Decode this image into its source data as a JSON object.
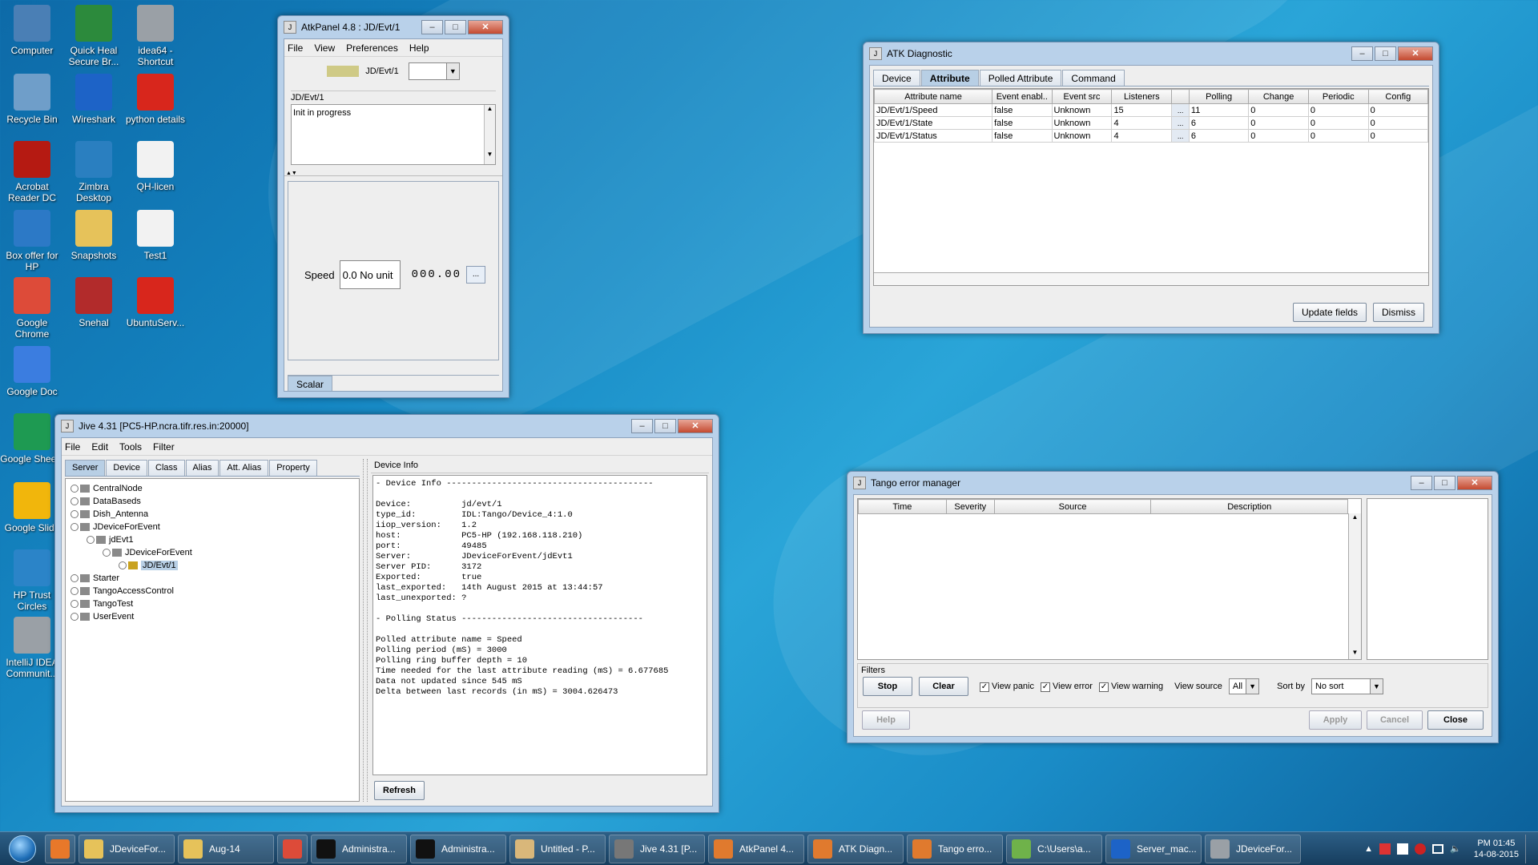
{
  "desktop_icons": [
    {
      "label": "Computer",
      "icon": "computer-icon",
      "color": "#4a7fb5"
    },
    {
      "label": "Quick Heal Secure Br...",
      "icon": "quick-heal-icon",
      "color": "#2c8a3c"
    },
    {
      "label": "idea64 - Shortcut",
      "icon": "intellij-icon",
      "color": "#9aa0a6"
    },
    {
      "label": "Recycle Bin",
      "icon": "recycle-bin-icon",
      "color": "#6f9ec9"
    },
    {
      "label": "Wireshark",
      "icon": "wireshark-icon",
      "color": "#1d63c7"
    },
    {
      "label": "python details",
      "icon": "pdf-icon",
      "color": "#d8261c"
    },
    {
      "label": "Acrobat Reader DC",
      "icon": "acrobat-icon",
      "color": "#b51a12"
    },
    {
      "label": "Zimbra Desktop",
      "icon": "zimbra-icon",
      "color": "#2a7fc0"
    },
    {
      "label": "QH-licen",
      "icon": "text-file-icon",
      "color": "#f2f2f2"
    },
    {
      "label": "Box offer for HP",
      "icon": "box-icon",
      "color": "#2c79c6"
    },
    {
      "label": "Snapshots",
      "icon": "folder-icon",
      "color": "#e6c25a"
    },
    {
      "label": "Test1",
      "icon": "binary-file-icon",
      "color": "#f2f2f2"
    },
    {
      "label": "Google Chrome",
      "icon": "chrome-icon",
      "color": "#dd4b39"
    },
    {
      "label": "Snehal",
      "icon": "winrar-icon",
      "color": "#b22b2b"
    },
    {
      "label": "UbuntuServ...",
      "icon": "pdf-icon",
      "color": "#d8261c"
    },
    {
      "label": "Google Doc",
      "icon": "google-docs-icon",
      "color": "#3b7de0"
    },
    {
      "label": "Google Sheets",
      "icon": "google-sheets-icon",
      "color": "#1e9a52"
    },
    {
      "label": "Google Slide",
      "icon": "google-slides-icon",
      "color": "#f1b60c"
    },
    {
      "label": "HP Trust Circles",
      "icon": "hp-trust-icon",
      "color": "#2b84c8"
    },
    {
      "label": "IntelliJ IDEA Communit...",
      "icon": "intellij-icon",
      "color": "#9aa0a6"
    }
  ],
  "atkpanel": {
    "title": "AtkPanel  4.8  : JD/Evt/1",
    "menu": [
      "File",
      "View",
      "Preferences",
      "Help"
    ],
    "device_name": "JD/Evt/1",
    "status_color": "#cfca86",
    "group_label": "JD/Evt/1",
    "status_text": "Init in progress",
    "attr_label": "Speed",
    "attr_value": "0.0 No unit",
    "wheel_digits": "000.00",
    "ellipsis": "...",
    "tab": "Scalar"
  },
  "atk_diagnostic": {
    "title": "ATK Diagnostic",
    "tabs": [
      "Device",
      "Attribute",
      "Polled Attribute",
      "Command"
    ],
    "selected_tab": 1,
    "columns": [
      "Attribute name",
      "Event enabl..",
      "Event src",
      "Listeners",
      "",
      "Polling",
      "Change",
      "Periodic",
      "Config"
    ],
    "rows": [
      [
        "JD/Evt/1/Speed",
        "false",
        "Unknown",
        "15",
        "...",
        "11",
        "0",
        "0",
        "0"
      ],
      [
        "JD/Evt/1/State",
        "false",
        "Unknown",
        "4",
        "...",
        "6",
        "0",
        "0",
        "0"
      ],
      [
        "JD/Evt/1/Status",
        "false",
        "Unknown",
        "4",
        "...",
        "6",
        "0",
        "0",
        "0"
      ]
    ],
    "update_label": "Update fields",
    "dismiss_label": "Dismiss"
  },
  "jive": {
    "title": "Jive 4.31  [PC5-HP.ncra.tifr.res.in:20000]",
    "menu": [
      "File",
      "Edit",
      "Tools",
      "Filter"
    ],
    "tabs": [
      "Server",
      "Device",
      "Class",
      "Alias",
      "Att. Alias",
      "Property"
    ],
    "tree": [
      {
        "label": "CentralNode",
        "level": 0
      },
      {
        "label": "DataBaseds",
        "level": 0
      },
      {
        "label": "Dish_Antenna",
        "level": 0
      },
      {
        "label": "JDeviceForEvent",
        "level": 0
      },
      {
        "label": "jdEvt1",
        "level": 1
      },
      {
        "label": "JDeviceForEvent",
        "level": 2
      },
      {
        "label": "JD/Evt/1",
        "level": 3,
        "selected": true
      },
      {
        "label": "Starter",
        "level": 0
      },
      {
        "label": "TangoAccessControl",
        "level": 0
      },
      {
        "label": "TangoTest",
        "level": 0
      },
      {
        "label": "UserEvent",
        "level": 0
      }
    ],
    "info_title": "Device Info",
    "info_lines": [
      "- Device Info -----------------------------------------",
      "",
      "Device:          jd/evt/1",
      "type_id:         IDL:Tango/Device_4:1.0",
      "iiop_version:    1.2",
      "host:            PC5-HP (192.168.118.210)",
      "port:            49485",
      "Server:          JDeviceForEvent/jdEvt1",
      "Server PID:      3172",
      "Exported:        true",
      "last_exported:   14th August 2015 at 13:44:57",
      "last_unexported: ?",
      "",
      "- Polling Status ------------------------------------",
      "",
      "Polled attribute name = Speed",
      "Polling period (mS) = 3000",
      "Polling ring buffer depth = 10",
      "Time needed for the last attribute reading (mS) = 6.677685",
      "Data not updated since 545 mS",
      "Delta between last records (in mS) = 3004.626473"
    ],
    "refresh_label": "Refresh"
  },
  "tango_error": {
    "title": "Tango error manager",
    "columns": [
      "Time",
      "Severity",
      "Source",
      "Description"
    ],
    "filters_label": "Filters",
    "stop_label": "Stop",
    "clear_label": "Clear",
    "view_panic": "View panic",
    "view_error": "View error",
    "view_warning": "View warning",
    "view_source_label": "View source",
    "view_source_value": "All",
    "sort_label": "Sort by",
    "sort_value": "No sort",
    "help_label": "Help",
    "apply_label": "Apply",
    "cancel_label": "Cancel",
    "close_label": "Close"
  },
  "taskbar": {
    "items": [
      {
        "label": "",
        "icon": "media-player-icon",
        "color": "#e8782a"
      },
      {
        "label": "JDeviceFor...",
        "icon": "folder-icon",
        "color": "#e6c25a"
      },
      {
        "label": "Aug-14",
        "icon": "folder-icon",
        "color": "#e6c25a"
      },
      {
        "label": "",
        "icon": "chrome-icon",
        "color": "#dd4b39"
      },
      {
        "label": "Administra...",
        "icon": "cmd-icon",
        "color": "#111111"
      },
      {
        "label": "Administra...",
        "icon": "cmd-icon",
        "color": "#111111"
      },
      {
        "label": "Untitled - P...",
        "icon": "paint-icon",
        "color": "#d9b77a"
      },
      {
        "label": "Jive 4.31  [P...",
        "icon": "java-icon",
        "color": "#777777"
      },
      {
        "label": "AtkPanel 4...",
        "icon": "java-icon",
        "color": "#e07a2e"
      },
      {
        "label": "ATK Diagn...",
        "icon": "java-icon",
        "color": "#e07a2e"
      },
      {
        "label": "Tango erro...",
        "icon": "java-icon",
        "color": "#e07a2e"
      },
      {
        "label": "C:\\Users\\a...",
        "icon": "notepad-icon",
        "color": "#6fb24a"
      },
      {
        "label": "Server_mac...",
        "icon": "wireshark-icon",
        "color": "#1d63c7"
      },
      {
        "label": "JDeviceFor...",
        "icon": "intellij-icon",
        "color": "#9aa0a6"
      }
    ],
    "clock_time": "PM 01:45",
    "clock_date": "14-08-2015"
  }
}
